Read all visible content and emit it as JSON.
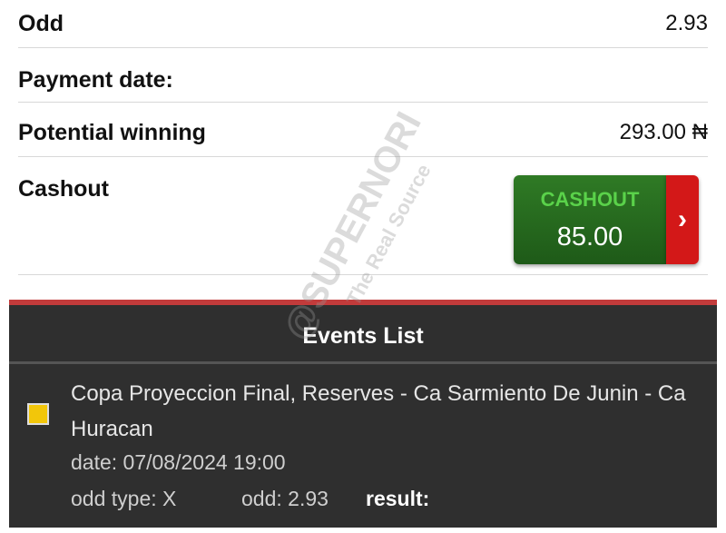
{
  "bet_details": {
    "odd_label": "Odd",
    "odd_value": "2.93",
    "payment_date_label": "Payment date:",
    "payment_date_value": "",
    "potential_winning_label": "Potential winning",
    "potential_winning_value": "293.00 ₦",
    "cashout_label": "Cashout"
  },
  "cashout_button": {
    "label": "CASHOUT",
    "amount": "85.00",
    "arrow_icon": "chevron-right-icon"
  },
  "watermark": {
    "line1": "@SUPERNORI",
    "line2": "The Real Source"
  },
  "events_list": {
    "title": "Events List",
    "events": [
      {
        "name": "Copa Proyeccion Final, Reserves - Ca Sarmiento De Junin - Ca Huracan",
        "date": "date: 07/08/2024 19:00",
        "odd_type": "odd type: X",
        "odd": "odd: 2.93",
        "result_label": "result:"
      }
    ]
  },
  "colors": {
    "cashout_green": "#2f7a25",
    "cashout_text_green": "#5ad24a",
    "arrow_red": "#d31818",
    "accent_red": "#c23b3b",
    "events_bg": "#2f2f2f",
    "status_yellow": "#f2c60a"
  }
}
